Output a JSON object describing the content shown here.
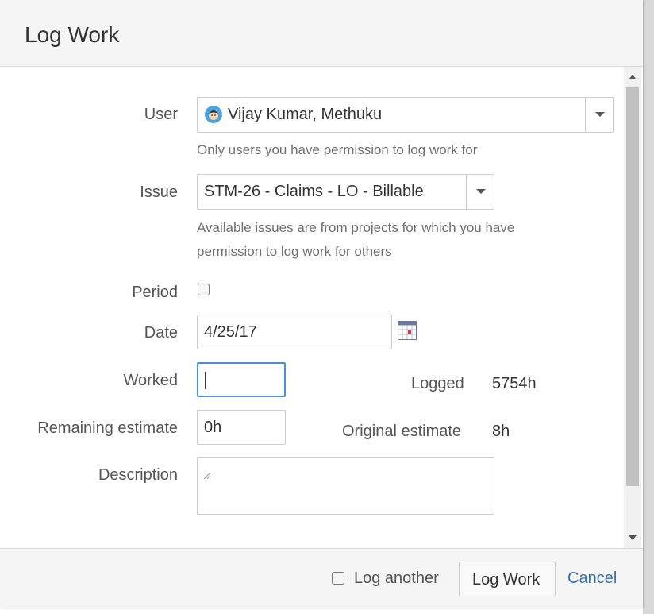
{
  "dialog": {
    "title": "Log Work"
  },
  "fields": {
    "user": {
      "label": "User",
      "value": "Vijay Kumar, Methuku",
      "help": "Only users you have permission to log work for"
    },
    "issue": {
      "label": "Issue",
      "value": "STM-26 - Claims - LO - Billable",
      "help_line1": "Available issues are from projects for which you have",
      "help_line2": "permission to log work for others"
    },
    "period": {
      "label": "Period",
      "checked": false
    },
    "date": {
      "label": "Date",
      "value": "4/25/17"
    },
    "worked": {
      "label": "Worked",
      "value": ""
    },
    "remaining": {
      "label": "Remaining estimate",
      "value": "0h"
    },
    "description": {
      "label": "Description",
      "value": ""
    }
  },
  "stats": {
    "logged_label": "Logged",
    "logged_value": "5754h",
    "original_label": "Original estimate",
    "original_value": "8h"
  },
  "footer": {
    "log_another_label": "Log another",
    "log_work_button": "Log Work",
    "cancel_link": "Cancel"
  },
  "colors": {
    "link": "#3572b0",
    "focus_border": "#4a90d9"
  }
}
